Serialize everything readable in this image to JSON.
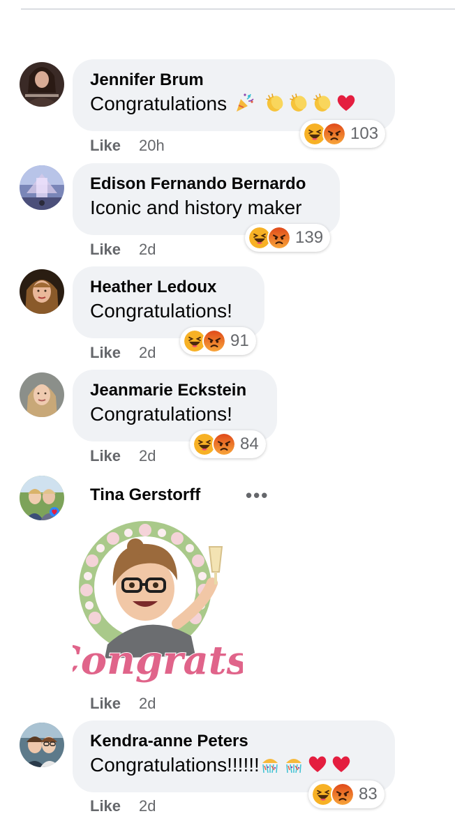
{
  "comments": [
    {
      "name": "Jennifer Brum",
      "text": "Congratulations",
      "emojis": [
        "party-popper",
        "clapping-hands",
        "clapping-hands",
        "clapping-hands",
        "red-heart"
      ],
      "like": "Like",
      "time": "20h",
      "reaction_count": "103",
      "reactions": [
        "haha",
        "angry"
      ]
    },
    {
      "name": "Edison Fernando Bernardo",
      "text": "Iconic and history maker",
      "emojis": [],
      "like": "Like",
      "time": "2d",
      "reaction_count": "139",
      "reactions": [
        "haha",
        "angry"
      ]
    },
    {
      "name": "Heather Ledoux",
      "text": "Congratulations!",
      "emojis": [],
      "like": "Like",
      "time": "2d",
      "reaction_count": "91",
      "reactions": [
        "haha",
        "angry"
      ]
    },
    {
      "name": "Jeanmarie Eckstein",
      "text": "Congratulations!",
      "emojis": [],
      "like": "Like",
      "time": "2d",
      "reaction_count": "84",
      "reactions": [
        "haha",
        "angry"
      ]
    },
    {
      "name": "Tina Gerstorff",
      "more": "•••",
      "sticker": {
        "icon": "congrats-avatar-sticker",
        "caption": "Congrats!"
      },
      "like": "Like",
      "time": "2d"
    },
    {
      "name": "Kendra-anne Peters",
      "text": "Congratulations!!!!!!",
      "emojis": [
        "confetti-ball",
        "confetti-ball",
        "red-heart",
        "red-heart"
      ],
      "like": "Like",
      "time": "2d",
      "reaction_count": "83",
      "reactions": [
        "haha",
        "angry"
      ]
    }
  ],
  "colors": {
    "bubble": "#f0f2f5",
    "meta_text": "#65676b",
    "haha": "#f7b125",
    "angry": "#e9710f",
    "heart": "#e41e3f",
    "congrats_pink": "#e0648a"
  }
}
